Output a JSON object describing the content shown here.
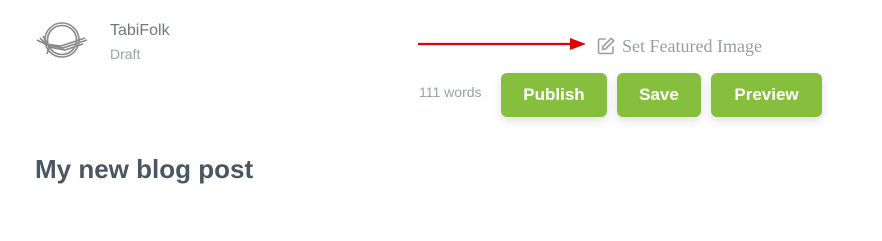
{
  "brand": {
    "logo_icon": "tabifolk-logo-icon",
    "name": "TabiFolk",
    "status": "Draft"
  },
  "annotation": {
    "icon": "red-arrow-icon",
    "color": "#e30000"
  },
  "featured_image": {
    "icon": "edit-icon",
    "label": "Set Featured Image"
  },
  "toolbar": {
    "word_count": "111 words",
    "publish_label": "Publish",
    "save_label": "Save",
    "preview_label": "Preview",
    "button_color": "#86bf3d"
  },
  "post": {
    "title": "My new blog post"
  }
}
